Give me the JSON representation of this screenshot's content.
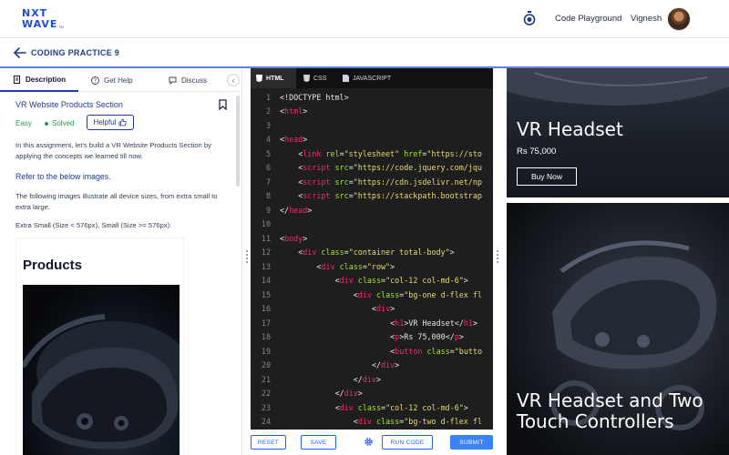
{
  "header": {
    "logo_line1": "NXT",
    "logo_line2": "WAVE",
    "logo_tm": "TM",
    "playground_label": "Code Playground",
    "user_name": "Vignesh"
  },
  "breadcrumb": {
    "title": "CODING PRACTICE 9"
  },
  "left_tabs": [
    {
      "label": "Description"
    },
    {
      "label": "Get Help"
    },
    {
      "label": "Discuss"
    }
  ],
  "collapse_glyph": "‹",
  "question": {
    "title": "VR Website Products Section",
    "difficulty": "Easy",
    "status": "Solved",
    "helpful_label": "Helpful",
    "paragraph1": "In this assignment, let's build a VR Website Products Section by applying the concepts we learned till now.",
    "paragraph2": "Refer to the below images.",
    "paragraph3": "The following images illustrate all device sizes, from extra small to extra large.",
    "paragraph4": "Extra Small (Size < 576px), Small (Size >= 576px):",
    "preview_heading": "Products"
  },
  "editor_tabs": [
    {
      "label": "HTML"
    },
    {
      "label": "CSS"
    },
    {
      "label": "JAVASCRIPT"
    }
  ],
  "code_lines": [
    {
      "n": "1",
      "text": "<!DOCTYPE html>"
    },
    {
      "n": "2",
      "text": "<html>"
    },
    {
      "n": "3",
      "text": ""
    },
    {
      "n": "4",
      "text": "<head>"
    },
    {
      "n": "5",
      "text": "    <link rel=\"stylesheet\" href=\"https://sto"
    },
    {
      "n": "6",
      "text": "    <script src=\"https://code.jquery.com/jqu"
    },
    {
      "n": "7",
      "text": "    <script src=\"https://cdn.jsdelivr.net/np"
    },
    {
      "n": "8",
      "text": "    <script src=\"https://stackpath.bootstrap"
    },
    {
      "n": "9",
      "text": "</head>"
    },
    {
      "n": "10",
      "text": ""
    },
    {
      "n": "11",
      "text": "<body>"
    },
    {
      "n": "12",
      "text": "    <div class=\"container total-body\">"
    },
    {
      "n": "13",
      "text": "        <div class=\"row\">"
    },
    {
      "n": "14",
      "text": "            <div class=\"col-12 col-md-6\">"
    },
    {
      "n": "15",
      "text": "                <div class=\"bg-one d-flex fl"
    },
    {
      "n": "16",
      "text": "                    <div>"
    },
    {
      "n": "17",
      "text": "                        <h1>VR Headset</h1>"
    },
    {
      "n": "18",
      "text": "                        <p>Rs 75,000</p>"
    },
    {
      "n": "19",
      "text": "                        <button class=\"butto"
    },
    {
      "n": "20",
      "text": "                    </div>"
    },
    {
      "n": "21",
      "text": "                </div>"
    },
    {
      "n": "22",
      "text": "            </div>"
    },
    {
      "n": "23",
      "text": "            <div class=\"col-12 col-md-6\">"
    },
    {
      "n": "24",
      "text": "                <div class=\"bg-two d-flex fl"
    }
  ],
  "editor_actions": {
    "reset": "RESET",
    "save": "SAVE",
    "run": "RUN CODE",
    "submit": "SUBMIT"
  },
  "output": {
    "card1_title": "VR Headset",
    "card1_price": "Rs 75,000",
    "card1_button": "Buy Now",
    "card2_title": "VR Headset and Two Touch Controllers"
  },
  "colors": {
    "brand": "#1d4ed8",
    "accent_line": "#5b83d9",
    "success": "#16a34a",
    "editor_bg": "#1e1e1e",
    "submit": "#3b82f6"
  }
}
